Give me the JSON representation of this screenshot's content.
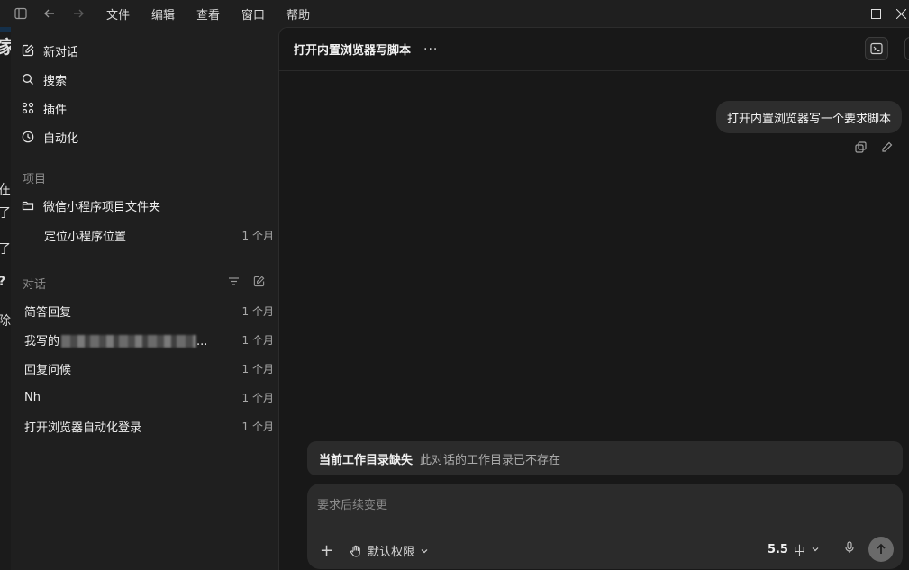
{
  "menu": [
    "文件",
    "编辑",
    "查看",
    "窗口",
    "帮助"
  ],
  "sidebar": {
    "nav": [
      {
        "label": "新对话",
        "icon": "edit-icon"
      },
      {
        "label": "搜索",
        "icon": "search-icon"
      },
      {
        "label": "插件",
        "icon": "plugins-icon"
      },
      {
        "label": "自动化",
        "icon": "clock-icon"
      }
    ],
    "projects_label": "项目",
    "project_folder": "微信小程序项目文件夹",
    "project_items": [
      {
        "title": "定位小程序位置",
        "time": "1 个月"
      }
    ],
    "chats_label": "对话",
    "chats": [
      {
        "title": "简答回复",
        "time": "1 个月"
      },
      {
        "title": "我写的",
        "time": "1 个月"
      },
      {
        "title": "回复问候",
        "time": "1 个月"
      },
      {
        "title": "Nh",
        "time": "1 个月"
      },
      {
        "title": "打开浏览器自动化登录",
        "time": "1 个月"
      }
    ],
    "chat_truncation": "..."
  },
  "main": {
    "title": "打开内置浏览器写脚本",
    "more": "···",
    "user_message": "打开内置浏览器写一个要求脚本",
    "warning_title": "当前工作目录缺失",
    "warning_text": "此对话的工作目录已不存在",
    "composer_placeholder": "要求后续变更",
    "permission_label": "默认权限",
    "model_version": "5.5",
    "model_level": "中"
  },
  "strip_glyphs": [
    "家",
    "在",
    "了",
    "了",
    "?",
    "除"
  ]
}
